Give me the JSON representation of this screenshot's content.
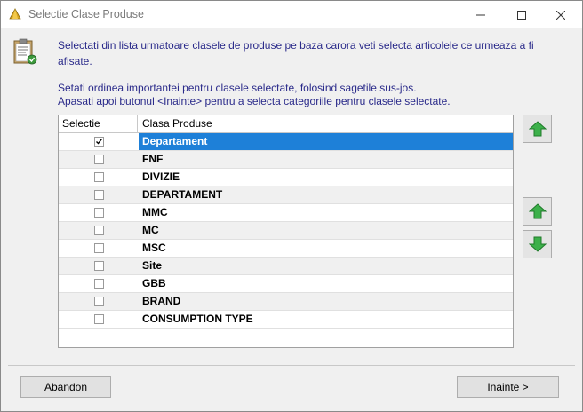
{
  "window": {
    "title": "Selectie Clase Produse",
    "icons": {
      "app": "app-icon",
      "minimize": "minimize-icon",
      "maximize": "maximize-icon",
      "close": "close-icon"
    }
  },
  "intro": {
    "line1": "Selectati din lista urmatoare clasele de produse pe baza carora veti selecta articolele ce urmeaza a fi",
    "line2": "afisate.",
    "line3": "Setati ordinea importantei pentru clasele selectate, folosind sagetile sus-jos.",
    "line4": "Apasati apoi butonul <Inainte> pentru a selecta categoriile pentru clasele selectate."
  },
  "grid": {
    "columns": [
      "Selectie",
      "Clasa Produse"
    ],
    "rows": [
      {
        "label": "Departament",
        "checked": true,
        "selected": true
      },
      {
        "label": "FNF",
        "checked": false
      },
      {
        "label": "DIVIZIE",
        "checked": false
      },
      {
        "label": "DEPARTAMENT",
        "checked": false
      },
      {
        "label": "MMC",
        "checked": false
      },
      {
        "label": "MC",
        "checked": false
      },
      {
        "label": "MSC",
        "checked": false
      },
      {
        "label": "Site",
        "checked": false
      },
      {
        "label": "GBB",
        "checked": false
      },
      {
        "label": "BRAND",
        "checked": false
      },
      {
        "label": "CONSUMPTION TYPE",
        "checked": false
      }
    ]
  },
  "side_buttons": {
    "top_icon": "arrow-up-icon",
    "move_up_icon": "arrow-up-icon",
    "move_down_icon": "arrow-down-icon"
  },
  "footer": {
    "abandon_label": "Abandon",
    "next_label": "Inainte >"
  },
  "colors": {
    "selection": "#1e80d8",
    "text_blue": "#2a2a8a",
    "arrow_green": "#3cb04a"
  }
}
